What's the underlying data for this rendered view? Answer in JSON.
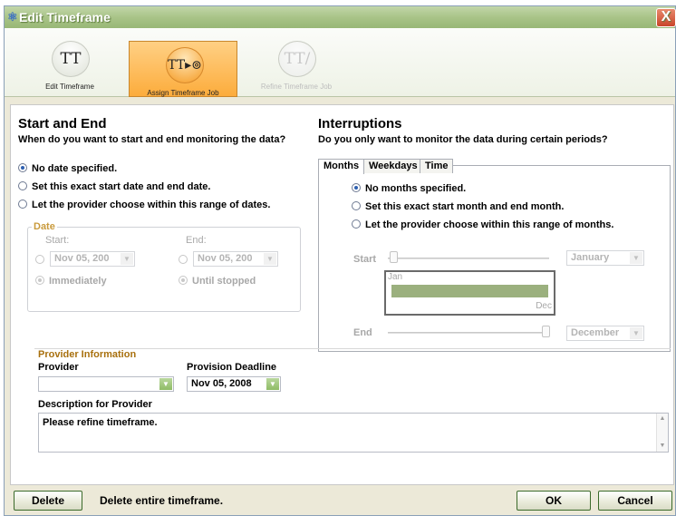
{
  "window": {
    "title": "Edit Timeframe",
    "close_label": "X"
  },
  "wizard": {
    "steps": [
      {
        "label": "Edit Timeframe",
        "icon": "timeframe-icon",
        "glyph": "TT"
      },
      {
        "label": "Assign Timeframe Job",
        "icon": "assign-job-icon",
        "glyph": "TT▸⊚"
      },
      {
        "label": "Refine Timeframe Job",
        "icon": "refine-job-icon",
        "glyph": "TT/"
      }
    ],
    "active_step": 1
  },
  "start_end": {
    "heading": "Start and End",
    "question": "When do you want to start and end monitoring the data?",
    "options": [
      "No date specified.",
      "Set this exact start date and end date.",
      "Let the provider choose within this range of dates."
    ],
    "selected": 0,
    "date_group": {
      "title": "Date",
      "start_label": "Start:",
      "end_label": "End:",
      "start_value": "Nov 05, 200",
      "end_value": "Nov 05, 200",
      "start_immediate": "Immediately",
      "end_until": "Until stopped"
    }
  },
  "interruptions": {
    "heading": "Interruptions",
    "question": "Do you only want to monitor the data during certain periods?",
    "tabs": [
      "Months",
      "Weekdays",
      "Time"
    ],
    "active_tab": 0,
    "options": [
      "No months specified.",
      "Set this exact start month and end month.",
      "Let the provider choose within this range of months."
    ],
    "selected": 0,
    "start_label": "Start",
    "end_label": "End",
    "start_month": "January",
    "end_month": "December",
    "range_from": "Jan",
    "range_to": "Dec"
  },
  "provider": {
    "section_title": "Provider Information",
    "provider_label": "Provider",
    "provider_value": "",
    "deadline_label": "Provision Deadline",
    "deadline_value": "Nov 05, 2008",
    "description_label": "Description for Provider",
    "description_value": "Please refine timeframe."
  },
  "footer": {
    "delete_label": "Delete",
    "delete_desc": "Delete entire timeframe.",
    "ok_label": "OK",
    "cancel_label": "Cancel"
  }
}
